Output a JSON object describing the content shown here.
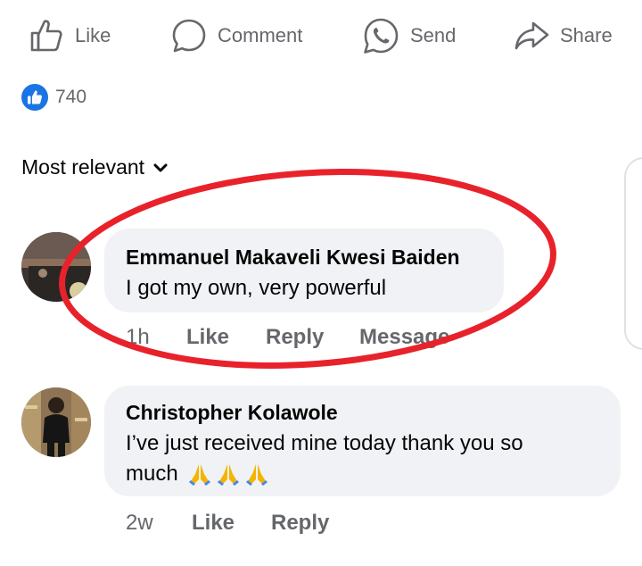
{
  "actions": {
    "like": "Like",
    "comment": "Comment",
    "send": "Send",
    "share": "Share"
  },
  "reactions": {
    "count": "740"
  },
  "sort": {
    "label": "Most relevant"
  },
  "comments": [
    {
      "author": "Emmanuel Makaveli Kwesi Baiden",
      "text": "I got my own,  very powerful",
      "time": "1h",
      "like": "Like",
      "reply": "Reply",
      "message": "Message"
    },
    {
      "author": "Christopher Kolawole",
      "text_line1": "I’ve just received mine today thank you so",
      "text_line2": "much",
      "time": "2w",
      "like": "Like",
      "reply": "Reply"
    }
  ],
  "colors": {
    "secondary_text": "#65676b",
    "bubble_bg": "#f0f2f5",
    "like_blue": "#1b74e4",
    "highlight_red": "#e8222b"
  }
}
